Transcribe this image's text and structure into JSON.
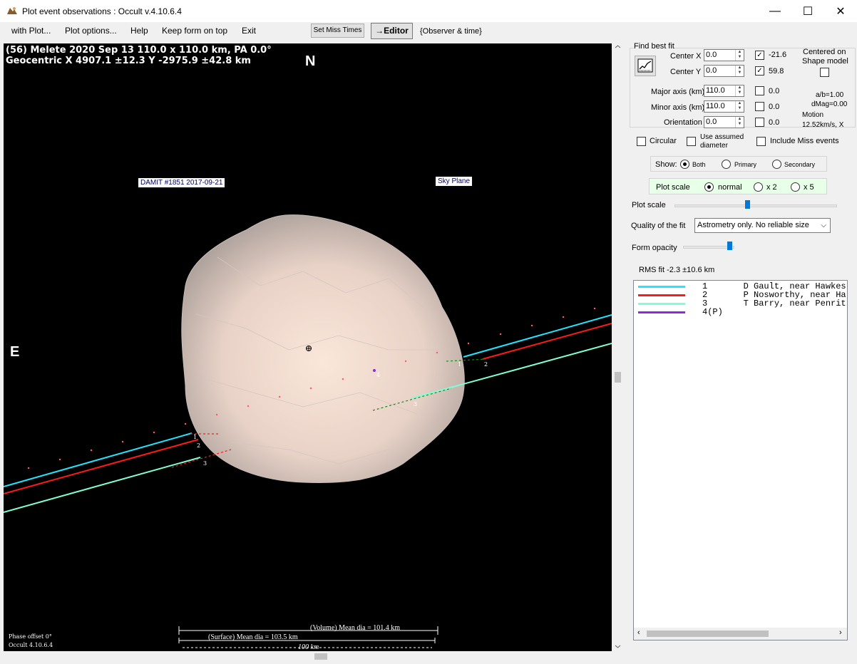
{
  "window": {
    "title": "Plot event observations : Occult v.4.10.6.4",
    "minimize_glyph": "—",
    "maximize_glyph": "☐",
    "close_glyph": "✕"
  },
  "menu": {
    "with_plot": "with Plot...",
    "plot_options": "Plot options...",
    "help": "Help",
    "keep_on_top": "Keep form on top",
    "exit": "Exit",
    "set_miss_times": "Set Miss Times",
    "editor": "→Editor",
    "observer_time": "{Observer & time}"
  },
  "plot": {
    "header_line1": "(56) Melete  2020 Sep 13  110.0 x 110.0 km, PA 0.0°",
    "header_line2": "Geocentric  X  4907.1 ±12.3  Y -2975.9 ±42.8 km",
    "north": "N",
    "east": "E",
    "damit_tag": "DAMIT #1851 2017-09-21",
    "sky_plane_tag": "Sky Plane",
    "volume_mean": "(Volume) Mean dia = 101.4 km",
    "surface_mean": "(Surface) Mean dia = 103.5 km",
    "scale_bar": "100 km",
    "phase_offset": "Phase offset 0°",
    "occult_version": "Occult 4.10.6.4",
    "chord_labels": [
      "1",
      "2",
      "3",
      "1",
      "2",
      "3",
      "4"
    ]
  },
  "panel": {
    "find_best_fit": "Find best fit",
    "center_x_label": "Center X",
    "center_x_value": "0.0",
    "center_x_result": "-21.6",
    "center_y_label": "Center Y",
    "center_y_value": "0.0",
    "center_y_result": "59.8",
    "centered_on": "Centered on",
    "shape_model": "Shape model",
    "major_axis_label": "Major axis (km)",
    "major_axis_value": "110.0",
    "major_axis_result": "0.0",
    "minor_axis_label": "Minor axis (km)",
    "minor_axis_value": "110.0",
    "minor_axis_result": "0.0",
    "orientation_label": "Orientation",
    "orientation_value": "0.0",
    "orientation_result": "0.0",
    "ab_ratio": "a/b=1.00",
    "dmag": "dMag=0.00",
    "motion_label": "Motion",
    "motion_value": "12.52km/s, X",
    "circular": "Circular",
    "use_assumed_1": "Use assumed",
    "use_assumed_2": "diameter",
    "include_miss": "Include Miss events",
    "show_label": "Show:",
    "show_both": "Both",
    "show_primary": "Primary",
    "show_secondary": "Secondary",
    "plot_scale_label": "Plot scale",
    "scale_normal": "normal",
    "scale_x2": "x 2",
    "scale_x5": "x 5",
    "plot_scale_slider_label": "Plot scale",
    "plot_scale_slider_fraction": 0.45,
    "quality_label": "Quality of the fit",
    "quality_value": "Astrometry only. No reliable size",
    "form_opacity_label": "Form opacity",
    "form_opacity_fraction": 0.95,
    "rms_fit": "RMS fit -2.3 ±10.6 km",
    "chk_center_x": "✓",
    "chk_center_y": "✓"
  },
  "observers": [
    {
      "color": "#22e5ff",
      "text": "1       D Gault, near Hawkes"
    },
    {
      "color": "#ff1a1a",
      "text": "2       P Nosworthy, near Ha"
    },
    {
      "color": "#7fffd4",
      "text": "3       T Barry, near Penrit"
    },
    {
      "color": "#8a2be2",
      "text": "4(P)"
    }
  ],
  "colors": {
    "chord1": "#22e5ff",
    "chord2": "#ff1a1a",
    "chord3": "#7fffd4",
    "accent": "#0078d7"
  }
}
